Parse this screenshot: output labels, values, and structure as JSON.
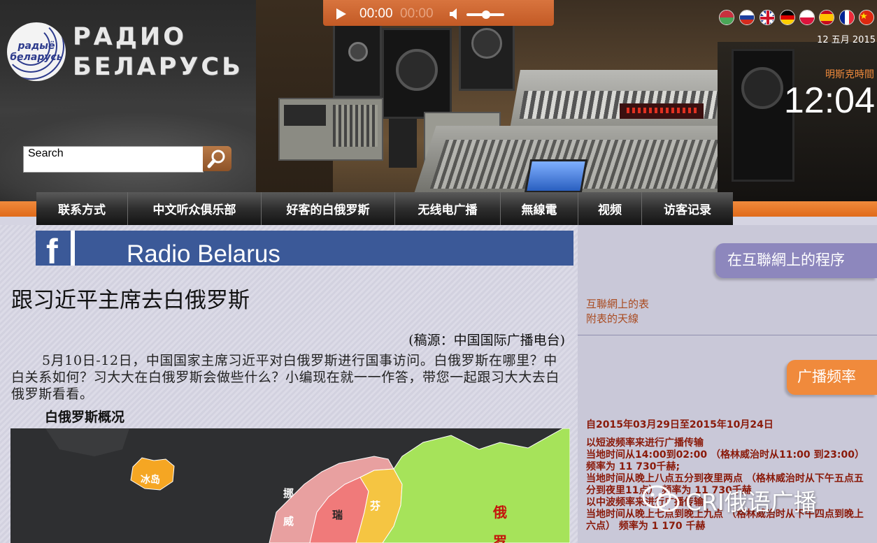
{
  "header": {
    "logo_small": "радыё беларусь",
    "logo_line1": "РАДИО",
    "logo_line2": "БЕЛАРУСЬ",
    "search_label": "Search"
  },
  "player": {
    "current_time": "00:00",
    "duration": "00:00",
    "volume_level": 0.5
  },
  "languages": [
    "belarusian-flag",
    "russian-flag",
    "uk-flag",
    "german-flag",
    "polish-flag",
    "spanish-flag",
    "french-flag",
    "chinese-flag"
  ],
  "date": "12 五月 2015",
  "timezone_label": "明斯克時間",
  "clock": "12:04",
  "nav": {
    "items": [
      {
        "label": "联系方式"
      },
      {
        "label": "中文听众俱乐部"
      },
      {
        "label": "好客的白俄罗斯"
      },
      {
        "label": "无线电广播"
      },
      {
        "label": "無線電"
      },
      {
        "label": "视频"
      },
      {
        "label": "访客记录"
      }
    ]
  },
  "facebook_banner": {
    "icon_letter": "f",
    "text": "Radio Belarus"
  },
  "article": {
    "title": "跟习近平主席去白俄罗斯",
    "source": "(稿源：中国国际广播电台)",
    "body": "5月10日-12日，中国国家主席习近平对白俄罗斯进行国事访问。白俄罗斯在哪里？中白关系如何？习大大在白俄罗斯会做些什么？小编现在就一一作答，带您一起跟习大大去白俄罗斯看看。",
    "subhead": "白俄罗斯概况"
  },
  "map": {
    "labels": [
      "冰岛",
      "挪",
      "威",
      "瑞",
      "芬",
      "俄",
      "罗"
    ]
  },
  "sidebar": {
    "programs_tab": "在互聯網上的程序",
    "links": [
      "互聯網上的表",
      "附表的天線"
    ],
    "freq_tab": "广播频率",
    "freq_lines": [
      "自2015年03月29日至2015年10月24日",
      "",
      "以短波频率来进行广播传输",
      "当地时间从14:00到02:00 （格林威治时从11:00 到23:00） 频率为 11 730千赫;",
      "当地时间从晚上八点五分到夜里两点 （格林威治时从下午五点五分到夜里11点） 频率为 11 730千赫",
      "以中波频率来进行广播传输",
      "当地时间从晚上七点到晚上九点 （格林威治时从下午四点到晚上六点） 频率为 1 170 千赫"
    ]
  },
  "watermark": {
    "text": "CRI俄语广播"
  },
  "colors": {
    "accent_orange": "#f08a3c",
    "facebook_blue": "#3b5998",
    "sidebar_purple": "#8d87bd",
    "link_brown": "#a94a1f"
  }
}
